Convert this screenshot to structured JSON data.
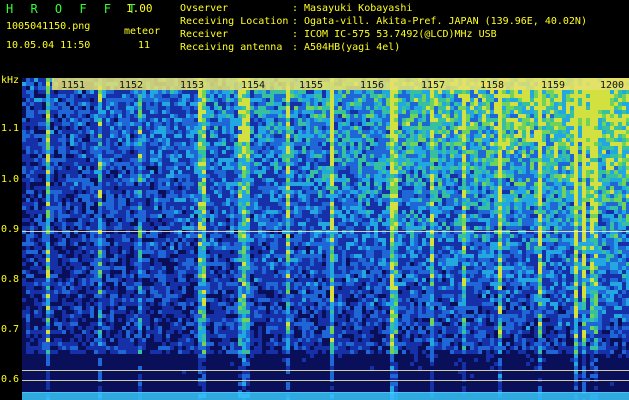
{
  "header": {
    "app_title": "H R O F F T",
    "version": "1.00",
    "filename": "1005041150.png",
    "datetime": "10.05.04 11:50",
    "meteor_label": "meteor",
    "meteor_count": "11",
    "info": [
      {
        "label": "Ovserver",
        "value": "Masayuki Kobayashi"
      },
      {
        "label": "Receiving Location",
        "value": "Ogata-vill. Akita-Pref. JAPAN (139.96E, 40.02N)"
      },
      {
        "label": "Receiver",
        "value": "ICOM IC-575 53.7492(@LCD)MHz USB"
      },
      {
        "label": "Receiving antenna",
        "value": "A504HB(yagi 4el)"
      }
    ],
    "colon": ":"
  },
  "axis": {
    "unit": "kHz",
    "y_ticks": [
      "1.1",
      "1.0",
      "0.9",
      "0.8",
      "0.7",
      "0.6"
    ],
    "x_ticks": [
      "1151",
      "1152",
      "1153",
      "1154",
      "1155",
      "1156",
      "1157",
      "1158",
      "1159",
      "1200"
    ]
  },
  "colors": {
    "green_text": "#33ff33",
    "yellow_text": "#ffff22",
    "background": "#000000",
    "spectrum_base": "#060a3a"
  }
}
